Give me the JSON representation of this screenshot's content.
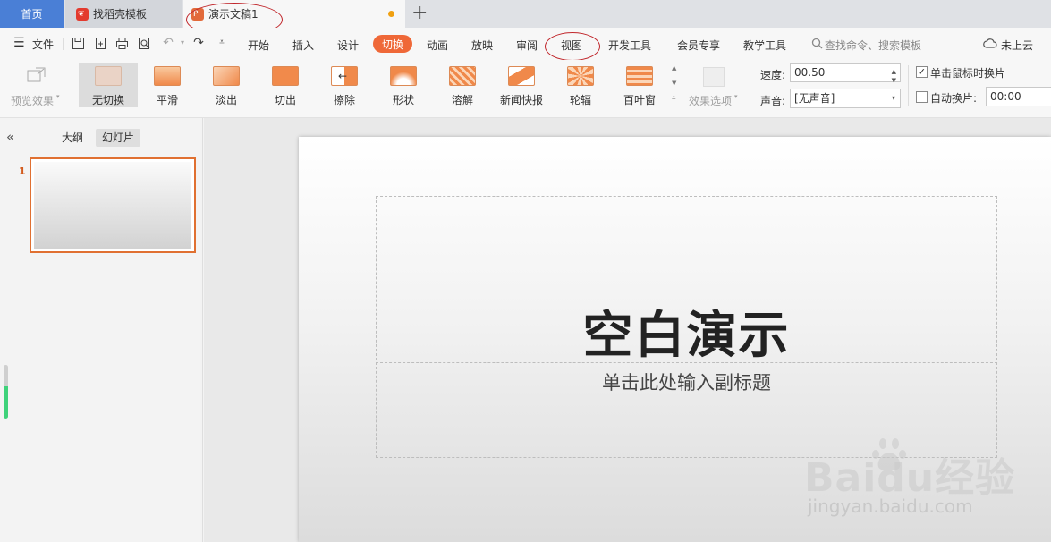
{
  "tabs": {
    "home": "首页",
    "templates": "找稻壳模板",
    "document": "演示文稿1"
  },
  "menu": {
    "file": "文件",
    "items": [
      "开始",
      "插入",
      "设计",
      "切换",
      "动画",
      "放映",
      "审阅",
      "视图",
      "开发工具",
      "会员专享",
      "教学工具"
    ],
    "active": "切换",
    "search": "查找命令、搜索模板",
    "cloud": "未上云"
  },
  "ribbon": {
    "preview": "预览效果",
    "effects": [
      "无切换",
      "平滑",
      "淡出",
      "切出",
      "擦除",
      "形状",
      "溶解",
      "新闻快报",
      "轮辐",
      "百叶窗"
    ],
    "selected_effect": "无切换",
    "effect_options": "效果选项",
    "speed_label": "速度:",
    "speed_value": "00.50",
    "sound_label": "声音:",
    "sound_value": "[无声音]",
    "on_click_label": "单击鼠标时换片",
    "on_click_checked": true,
    "auto_label": "自动换片:",
    "auto_checked": false,
    "auto_value": "00:00"
  },
  "panel": {
    "collapse": "«",
    "outline_tab": "大纲",
    "slides_tab": "幻灯片",
    "slide_number": "1"
  },
  "slide": {
    "title": "空白演示",
    "subtitle": "单击此处输入副标题"
  },
  "watermark": {
    "brand": "Baidu经验",
    "url": "jingyan.baidu.com"
  },
  "colors": {
    "accent": "#ef6838",
    "home_tab": "#4a7fd6",
    "annotation": "#c0252a"
  }
}
